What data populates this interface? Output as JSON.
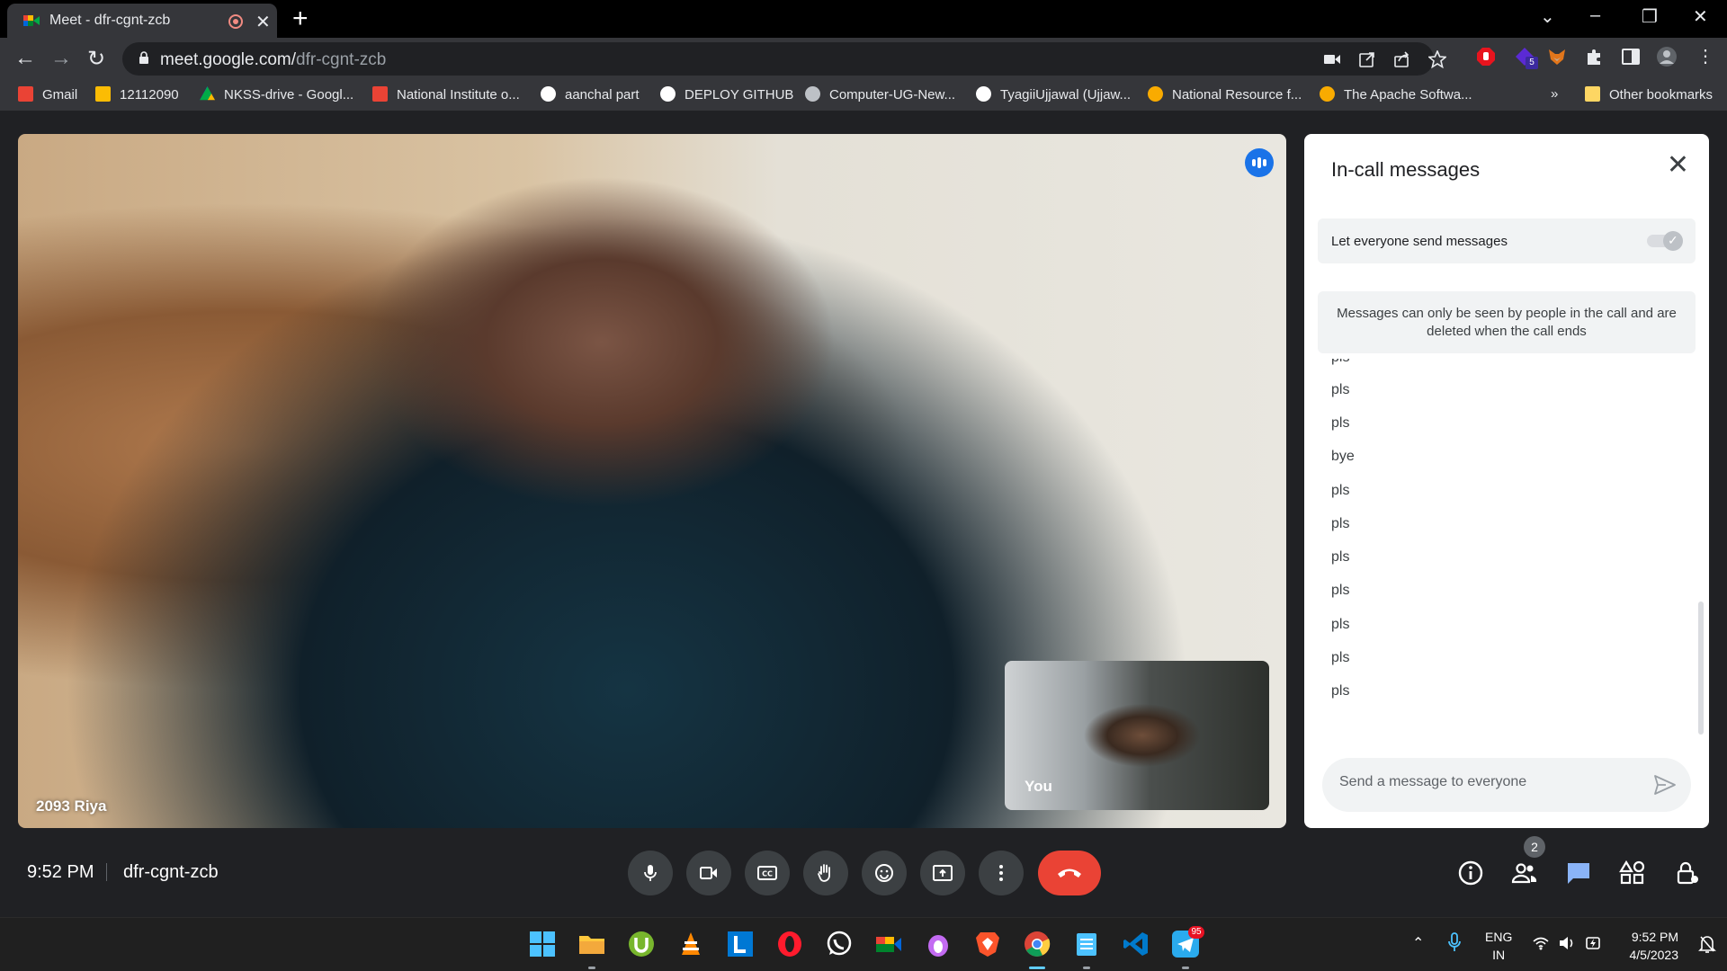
{
  "browser": {
    "tab": {
      "title": "Meet - dfr-cgnt-zcb",
      "close_glyph": "✕"
    },
    "new_tab_glyph": "+",
    "window_controls": [
      "⌄",
      "–",
      "❐",
      "✕"
    ],
    "url": {
      "host": "meet.google.com/",
      "path": "dfr-cgnt-zcb"
    },
    "extensions_badge": "5"
  },
  "bookmarks": [
    {
      "label": "Gmail",
      "color": "#ea4335"
    },
    {
      "label": "12112090",
      "color": "#fbbc04"
    },
    {
      "label": "NKSS-drive - Googl...",
      "color": "#34a853"
    },
    {
      "label": "National Institute o...",
      "color": "#ea4335"
    },
    {
      "label": "aanchal part",
      "color": "#ffffff"
    },
    {
      "label": "DEPLOY GITHUB",
      "color": "#ffffff"
    },
    {
      "label": "Computer-UG-New...",
      "color": "#ffffff"
    },
    {
      "label": "TyagiiUjjawal (Ujjaw...",
      "color": "#ffffff"
    },
    {
      "label": "National Resource f...",
      "color": "#f9ab00"
    },
    {
      "label": "The Apache Softwa...",
      "color": "#f9ab00"
    }
  ],
  "bookmarks_overflow": "»",
  "other_bookmarks": "Other bookmarks",
  "meet": {
    "main_participant": "2093 Riya",
    "self_label": "You",
    "time": "9:52 PM",
    "code": "dfr-cgnt-zcb",
    "participants_count": "2",
    "accent": "#1a73e8",
    "hangup_color": "#ea4335"
  },
  "panel": {
    "title": "In-call messages",
    "toggle_label": "Let everyone send messages",
    "toggle_on": true,
    "notice": "Messages can only be seen by people in the call and are deleted when the call ends",
    "messages": [
      "pls",
      "pls",
      "pls",
      "bye",
      "pls",
      "pls",
      "pls",
      "pls",
      "pls",
      "pls",
      "pls"
    ],
    "input_placeholder": "Send a message to everyone"
  },
  "taskbar": {
    "apps": [
      "windows-start",
      "file-explorer",
      "utorrent",
      "vlc",
      "l-app",
      "opera",
      "whatsapp",
      "camera",
      "onion",
      "brave",
      "chrome",
      "notepad",
      "vscode",
      "telegram"
    ],
    "telegram_badge": "95",
    "lang_line1": "ENG",
    "lang_line2": "IN",
    "time": "9:52 PM",
    "date": "4/5/2023"
  }
}
